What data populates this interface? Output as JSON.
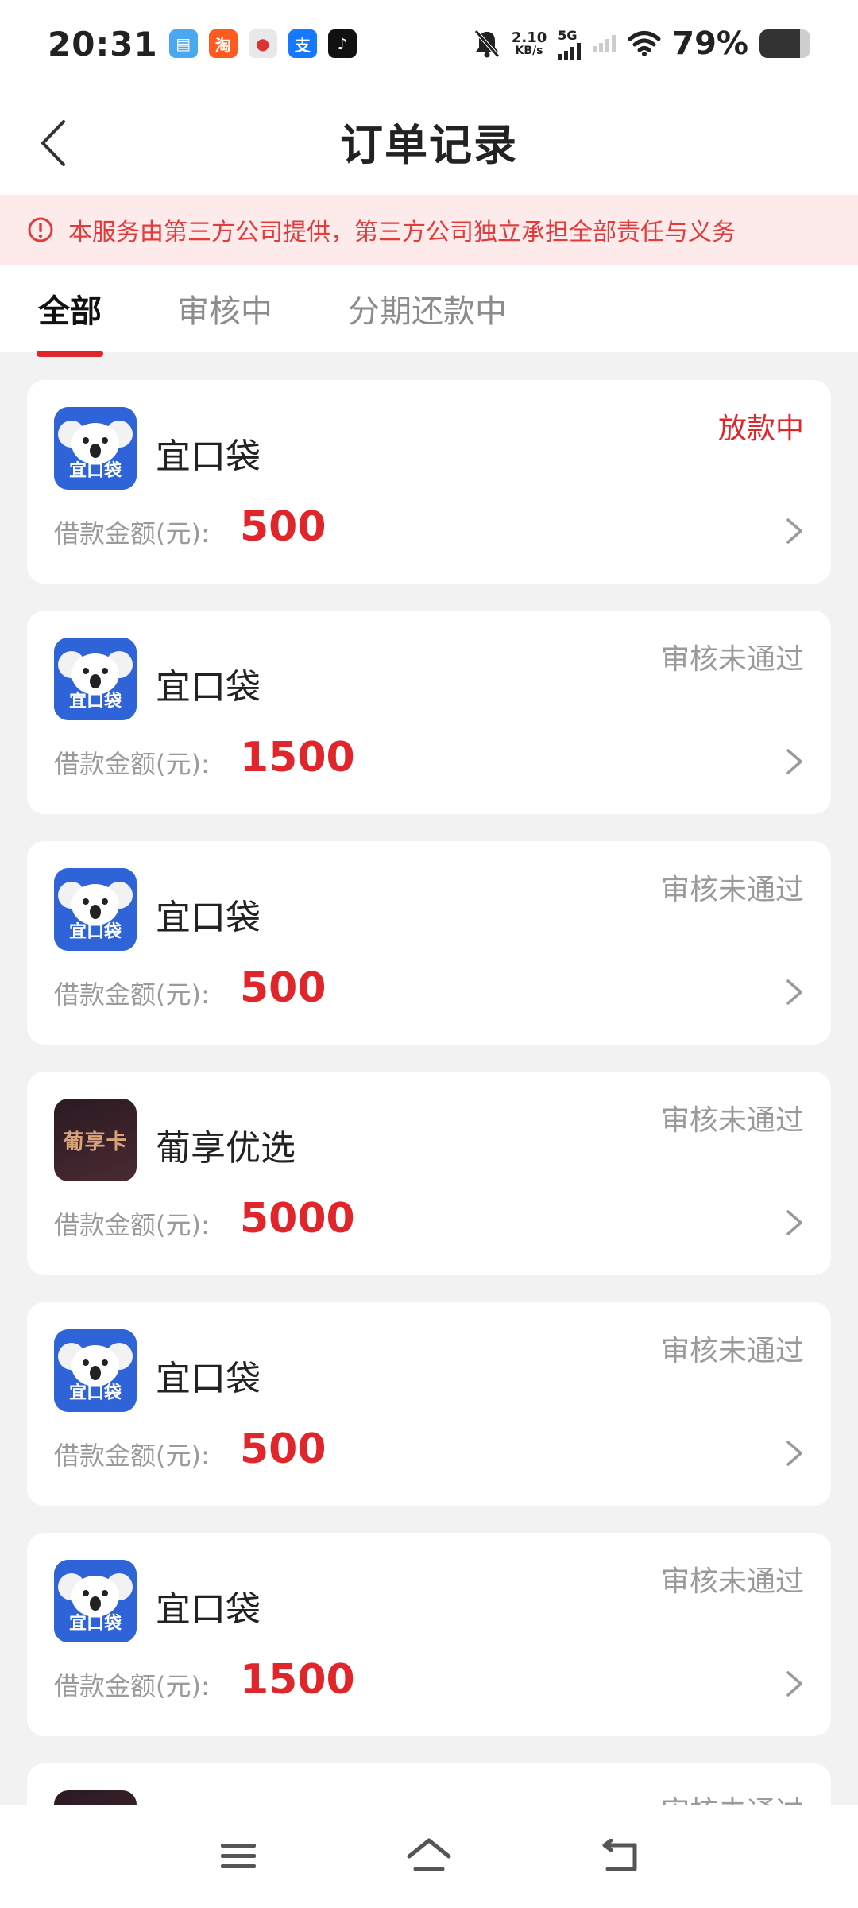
{
  "status_bar": {
    "time": "20:31",
    "net_speed_value": "2.10",
    "net_speed_unit": "KB/s",
    "network_type": "5G",
    "battery_percent": "79%",
    "battery_level": 0.79,
    "notification_icons": [
      "wallet-app-icon",
      "taobao-app-icon",
      "video-app-icon",
      "alipay-app-icon",
      "tiktok-app-icon"
    ]
  },
  "header": {
    "title": "订单记录"
  },
  "notice": {
    "text": "本服务由第三方公司提供，第三方公司独立承担全部责任与义务"
  },
  "tabs": [
    {
      "label": "全部",
      "active": true
    },
    {
      "label": "审核中",
      "active": false
    },
    {
      "label": "分期还款中",
      "active": false
    }
  ],
  "orders": [
    {
      "name": "宜口袋",
      "status": "放款中",
      "amount_label": "借款金额(元):",
      "amount": "500",
      "logo": "koala-logo"
    },
    {
      "name": "宜口袋",
      "status": "审核未通过",
      "amount_label": "借款金额(元):",
      "amount": "1500",
      "logo": "koala-logo"
    },
    {
      "name": "宜口袋",
      "status": "审核未通过",
      "amount_label": "借款金额(元):",
      "amount": "500",
      "logo": "koala-logo"
    },
    {
      "name": "葡享优选",
      "status": "审核未通过",
      "amount_label": "借款金额(元):",
      "amount": "5000",
      "logo": "card-logo",
      "logo_text": "葡享卡"
    },
    {
      "name": "宜口袋",
      "status": "审核未通过",
      "amount_label": "借款金额(元):",
      "amount": "500",
      "logo": "koala-logo"
    },
    {
      "name": "宜口袋",
      "status": "审核未通过",
      "amount_label": "借款金额(元):",
      "amount": "1500",
      "logo": "koala-logo"
    },
    {
      "name": "",
      "status": "审核未通过",
      "amount_label": "",
      "amount": "",
      "logo": "card-logo",
      "logo_text": ""
    }
  ],
  "koala_logo_text": "宜口袋",
  "colors": {
    "accent": "#e0262b",
    "notice_bg": "#fdeaea",
    "muted": "#9a9a9a"
  }
}
